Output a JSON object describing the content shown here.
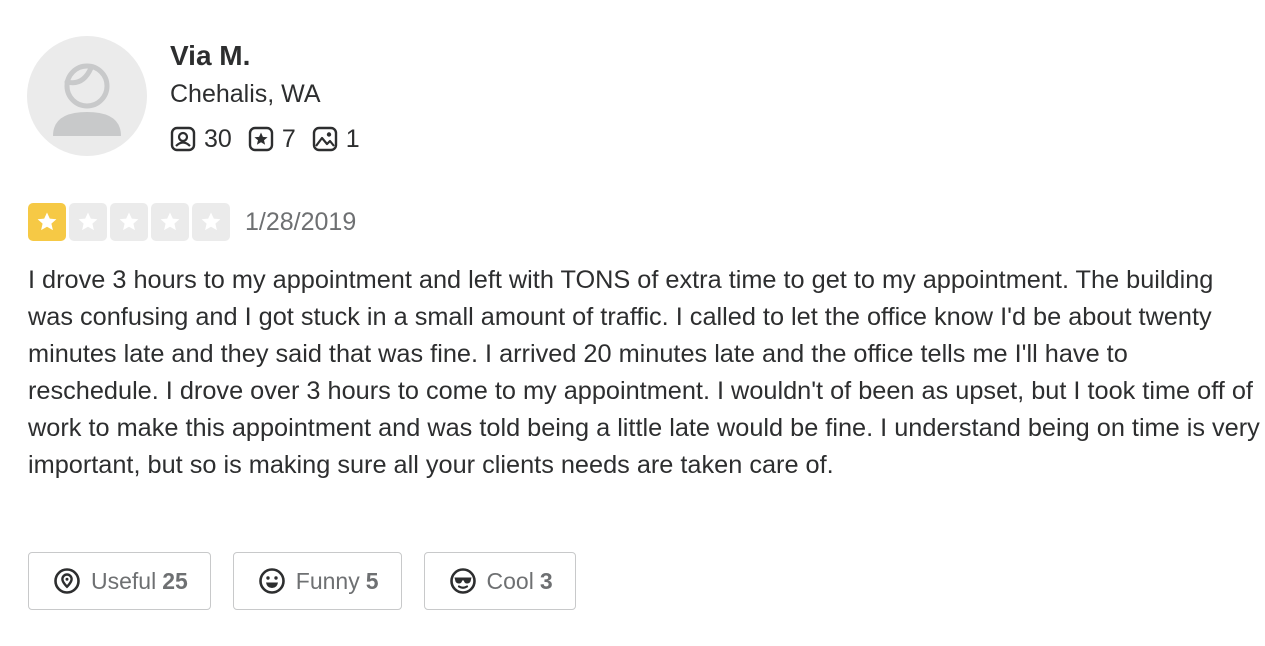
{
  "user": {
    "name": "Via M.",
    "location": "Chehalis, WA",
    "avatar_icon": "default-user-avatar-icon",
    "stats": {
      "friends": "30",
      "reviews": "7",
      "photos": "1"
    }
  },
  "review": {
    "rating": 1,
    "max_rating": 5,
    "date": "1/28/2019",
    "text": "I drove 3 hours to my appointment and left with TONS of extra time to get to my appointment. The building was confusing and I got stuck in a small amount of traffic. I called to let the office know I'd be about twenty minutes late and they said that was fine. I arrived 20 minutes late and the office tells me I'll have to reschedule. I drove over 3 hours to come to my appointment. I wouldn't of been as upset, but I took time off of work to make this appointment and was told being a little late would be fine. I understand being on time is very important, but so is making sure all your clients needs are taken care of."
  },
  "reactions": {
    "useful": {
      "label": "Useful",
      "count": "25"
    },
    "funny": {
      "label": "Funny",
      "count": "5"
    },
    "cool": {
      "label": "Cool",
      "count": "3"
    }
  },
  "colors": {
    "star_filled": "#f6c945",
    "star_empty": "#ebebeb",
    "text_primary": "#2d2e2f",
    "text_secondary": "#6e7072"
  }
}
